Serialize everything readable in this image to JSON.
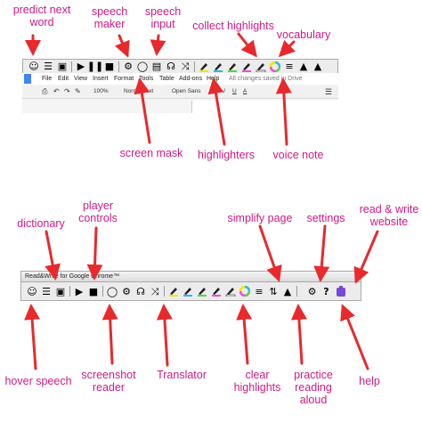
{
  "top_labels": {
    "predict_next_word": [
      "predict next",
      "word"
    ],
    "speech_maker": [
      "speech",
      "maker"
    ],
    "speech_input": [
      "speech",
      "input"
    ],
    "collect_highlights": "collect highlights",
    "vocabulary": "vocabulary",
    "screen_mask": "screen mask",
    "highlighters": "highlighters",
    "voice_note": "voice note"
  },
  "bottom_labels": {
    "dictionary": "dictionary",
    "player_controls": [
      "player",
      "controls"
    ],
    "simplify_page": "simplify page",
    "settings": "settings",
    "read_write_website": [
      "read & write",
      "website"
    ],
    "hover_speech": "hover speech",
    "screenshot_reader": [
      "screenshot",
      "reader"
    ],
    "translator": "Translator",
    "clear_highlights": [
      "clear",
      "highlights"
    ],
    "practice_reading_aloud": [
      "practice",
      "reading",
      "aloud"
    ],
    "help": "help"
  },
  "docs": {
    "menu": [
      "File",
      "Edit",
      "View",
      "Insert",
      "Format",
      "Tools",
      "Table",
      "Add-ons",
      "Help"
    ],
    "save_status": "All changes saved in Drive",
    "zoom": "100%",
    "style": "Normal text",
    "font": "Open Sans"
  },
  "extension_title": "Read&Write for Google Chrome™",
  "colors": {
    "label": "#d01a85",
    "arrow": "#e8292d",
    "toolbar_bg": "#ececec",
    "highlight_yellow": "#f2e600",
    "highlight_blue": "#2ab7f0",
    "highlight_green": "#57d14b",
    "highlight_pink": "#f04bd8",
    "extension_purple": "#7a48d6"
  },
  "icons": {
    "top_toolbar": [
      "predict-icon",
      "dictionary-book-icon",
      "picture-dictionary-icon",
      "play-icon",
      "pause-icon",
      "stop-icon",
      "speech-maker-icon",
      "screenshot-reader-icon",
      "speech-input-icon",
      "headphones-icon",
      "translator-icon",
      "highlight-yellow-icon",
      "highlight-blue-icon",
      "highlight-green-icon",
      "highlight-pink-icon",
      "clear-highlights-icon",
      "collect-highlights-icon",
      "vocabulary-list-icon",
      "voice-note-icon",
      "screen-mask-icon"
    ],
    "bottom_toolbar": [
      "hover-speech-icon",
      "dictionary-book-icon",
      "picture-dictionary-icon",
      "play-icon",
      "stop-icon",
      "screenshot-reader-icon",
      "speech-maker-icon",
      "headphones-icon",
      "translator-icon",
      "highlight-yellow-icon",
      "highlight-blue-icon",
      "highlight-green-icon",
      "highlight-pink-icon",
      "clear-highlights-icon",
      "collect-highlights-icon",
      "vocabulary-list-icon",
      "simplify-page-icon",
      "practice-reading-icon",
      "settings-gear-icon",
      "help-question-icon",
      "read-write-website-icon"
    ]
  }
}
